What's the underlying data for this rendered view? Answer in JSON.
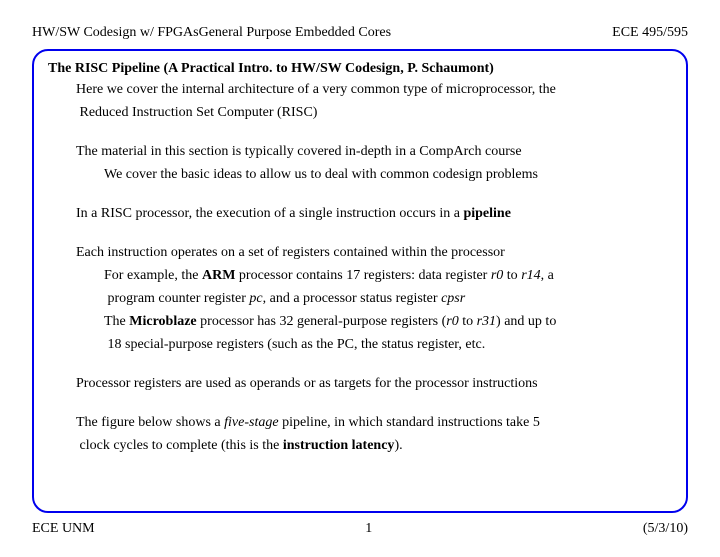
{
  "header": {
    "left": "HW/SW Codesign w/ FPGAsGeneral Purpose Embedded Cores",
    "right": "ECE 495/595"
  },
  "title": "The RISC Pipeline (A Practical Intro. to HW/SW Codesign, P. Schaumont)",
  "line1": "Here we cover the internal architecture of a very common type of microprocessor, the",
  "line2": "Reduced Instruction Set Computer (RISC)",
  "line3": "The material in this section is typically covered in-depth in a CompArch course",
  "line4": "We cover the basic ideas to allow us to deal with common codesign problems",
  "line5a": "In a RISC processor, the execution of a single instruction occurs in a ",
  "line5b": "pipeline",
  "line6": "Each instruction operates on a set of registers contained within the processor",
  "line7a": "For example, the ",
  "line7b": "ARM",
  "line7c": " processor contains 17 registers: data register ",
  "line7d": "r0",
  "line7e": " to ",
  "line7f": "r14",
  "line7g": ", a",
  "line8a": "program counter register ",
  "line8b": "pc",
  "line8c": ", and a processor status register ",
  "line8d": "cpsr",
  "line9a": "The ",
  "line9b": "Microblaze",
  "line9c": " processor has 32 general-purpose registers (",
  "line9d": "r0",
  "line9e": " to ",
  "line9f": "r31",
  "line9g": ") and up to",
  "line10": "18 special-purpose registers (such as the PC, the status register, etc.",
  "line11": "Processor registers are used as operands or as targets for the processor instructions",
  "line12a": "The figure below shows a ",
  "line12b": "five-stage",
  "line12c": " pipeline, in which standard instructions take 5",
  "line13a": "clock cycles to complete (this is the ",
  "line13b": "instruction latency",
  "line13c": ").",
  "footer": {
    "left": "ECE UNM",
    "center": "1",
    "right": "(5/3/10)"
  }
}
